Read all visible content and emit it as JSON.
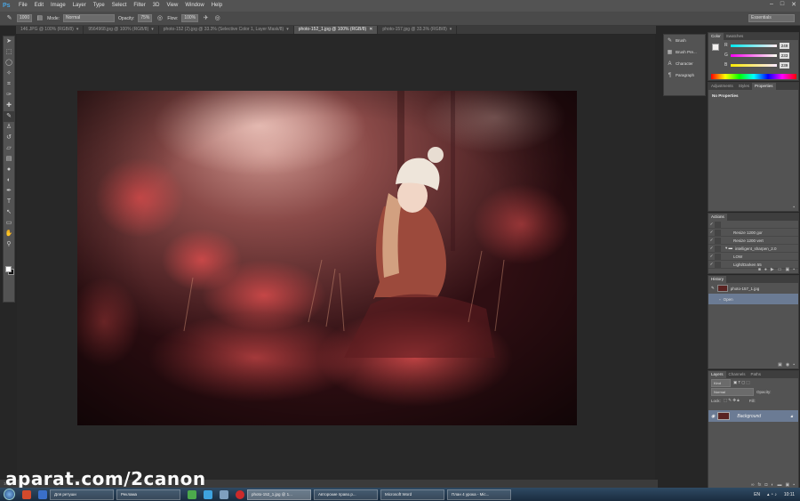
{
  "app": {
    "logo": "Ps",
    "menu": [
      "File",
      "Edit",
      "Image",
      "Layer",
      "Type",
      "Select",
      "Filter",
      "3D",
      "View",
      "Window",
      "Help"
    ],
    "window_controls": [
      "–",
      "□",
      "✕"
    ]
  },
  "options_bar": {
    "brush_size": "1000",
    "mode_label": "Mode:",
    "mode_value": "Normal",
    "opacity_label": "Opacity:",
    "opacity_value": "75%",
    "flow_label": "Flow:",
    "flow_value": "100%",
    "workspace": "Essentials"
  },
  "tabs": [
    {
      "label": "146.JPG @ 100% (RGB/8)",
      "active": false
    },
    {
      "label": "9564968.jpg @ 100% (RGB/8)",
      "active": false
    },
    {
      "label": "photo-152 (2).jpg @ 33.3% (Selective Color 1, Layer Mask/8)",
      "active": false
    },
    {
      "label": "photo-152_1.jpg @ 100% (RGB/8)",
      "active": true
    },
    {
      "label": "photo-157.jpg @ 33.3% (RGB/8)",
      "active": false
    }
  ],
  "dock": [
    {
      "icon": "brush-icon",
      "glyph": "✎",
      "label": "Brush"
    },
    {
      "icon": "brush-presets-icon",
      "glyph": "▦",
      "label": "Brush Pre..."
    },
    {
      "icon": "character-icon",
      "glyph": "A",
      "label": "Character"
    },
    {
      "icon": "paragraph-icon",
      "glyph": "¶",
      "label": "Paragraph"
    }
  ],
  "color_panel": {
    "tabs": [
      "Color",
      "Swatches"
    ],
    "channels": [
      {
        "letter": "R",
        "value": "249",
        "gradient": "linear-gradient(90deg,#00e9ef,#ffe9ef)"
      },
      {
        "letter": "G",
        "value": "233",
        "gradient": "linear-gradient(90deg,#f900ef,#f9ffef)"
      },
      {
        "letter": "B",
        "value": "239",
        "gradient": "linear-gradient(90deg,#f9e900,#f9e9ff)"
      }
    ]
  },
  "properties_panel": {
    "tabs": [
      "Adjustments",
      "Styles",
      "Properties"
    ],
    "text": "No Properties"
  },
  "actions_panel": {
    "tabs": [
      "Actions"
    ],
    "rows": [
      {
        "label": "",
        "indent": 3
      },
      {
        "label": "Resize 1200 gor",
        "indent": 3
      },
      {
        "label": "Resize 1200 vert",
        "indent": 3
      },
      {
        "label": "intelligent_sharpen_2.0",
        "indent": 1
      },
      {
        "label": "LOW",
        "indent": 3
      },
      {
        "label": "Light/Darken 55",
        "indent": 3
      }
    ]
  },
  "history_panel": {
    "tabs": [
      "History"
    ],
    "rows": [
      {
        "label": "photo-157_1.jpg",
        "selected": false,
        "thumb": true
      },
      {
        "label": "Open",
        "selected": true,
        "thumb": false
      }
    ]
  },
  "layers_panel": {
    "tabs": [
      "Layers",
      "Channels",
      "Paths"
    ],
    "kind_label": "Kind",
    "blend_mode": "Normal",
    "opacity_label": "Opacity:",
    "lock_label": "Lock:",
    "fill_label": "Fill:",
    "layer_name": "Background"
  },
  "status_bar": {
    "text": "100%"
  },
  "watermark": "aparat.com/2canon",
  "taskbar": {
    "tasks": [
      {
        "label": "Для ретуши",
        "active": false
      },
      {
        "label": "Реклама",
        "active": false
      },
      {
        "label": "photo-152_1.jpg @ 1...",
        "active": true
      },
      {
        "label": "Авторские право.p...",
        "active": false
      },
      {
        "label": "Microsoft Word",
        "active": false
      },
      {
        "label": "План 4 урока - Mic...",
        "active": false
      }
    ],
    "lang": "EN",
    "time": "10:11"
  }
}
